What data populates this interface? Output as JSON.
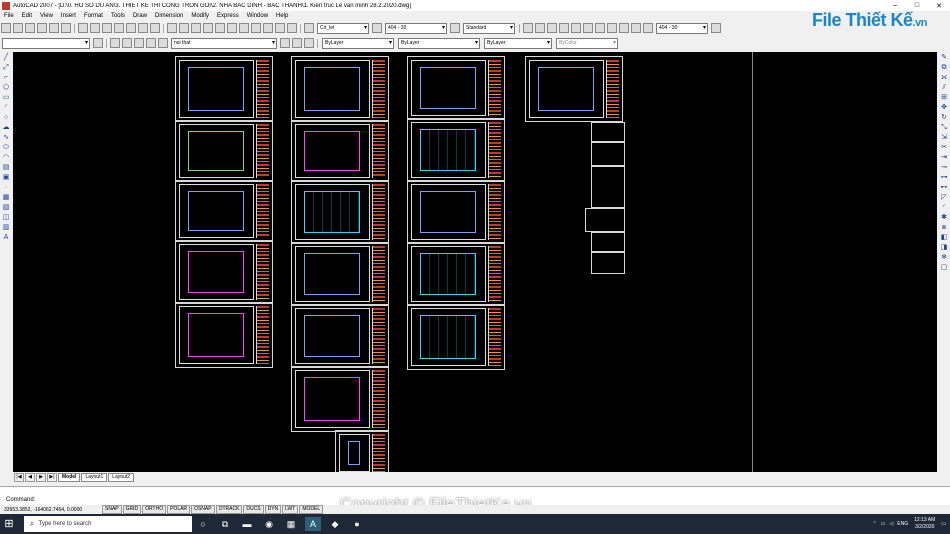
{
  "window": {
    "title": "AutoCAD 2007 - [D:\\0. HO SO DU AN\\3. THIET KE THI CONG TRON GOI\\2. NHA BAC DINH - BAC THANH\\1. Kien truc Le van minh 28.2.2020.dwg]",
    "controls": [
      "–",
      "□",
      "✕"
    ]
  },
  "brand": {
    "name": "File Thiết Kế",
    "domain": ".vn"
  },
  "menu": [
    "File",
    "Edit",
    "View",
    "Insert",
    "Format",
    "Tools",
    "Draw",
    "Dimension",
    "Modify",
    "Express",
    "Window",
    "Help"
  ],
  "toolbar_standard": {
    "textstyle": "Cir_let",
    "dimstyle": "404 - 30",
    "tablestyle": "Standard",
    "mleaderstyle": "404 - 30"
  },
  "toolbar_layers": {
    "workspace": "",
    "layer": "noi that",
    "color": "ByLayer",
    "linetype": "ByLayer",
    "lineweight": "ByLayer",
    "plotstyle": "ByColor"
  },
  "tabs": [
    "Model",
    "Layout1",
    "Layout2"
  ],
  "command": {
    "history": "",
    "prompt": "Command:"
  },
  "status": {
    "coordinates": "33953.3852, -164062.7454, 0.0000",
    "toggles": [
      "SNAP",
      "GRID",
      "ORTHO",
      "POLAR",
      "OSNAP",
      "OTRACK",
      "DUCS",
      "DYN",
      "LWT",
      "MODEL"
    ]
  },
  "watermark": "Copyright © FileThietKe.vn",
  "taskbar": {
    "search_placeholder": "Type here to search",
    "language": "ENG",
    "time": "12:13 AM",
    "date": "3/2/2020"
  }
}
